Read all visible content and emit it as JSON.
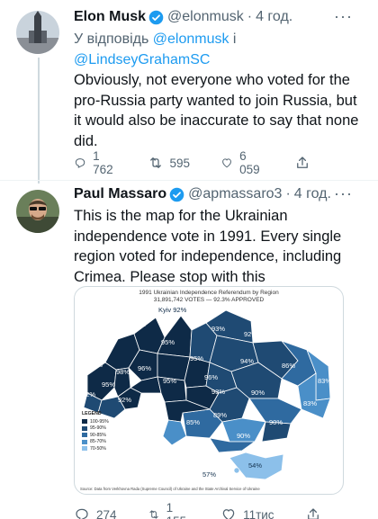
{
  "tweets": [
    {
      "display_name": "Elon Musk",
      "handle": "@elonmusk",
      "separator": "·",
      "time": "4 год.",
      "reply_prefix": "У відповідь",
      "reply_users": [
        "@elonmusk",
        "і",
        "@LindseyGrahamSC"
      ],
      "text": "Obviously, not everyone who voted for the pro-Russia party wanted to join Russia, but it would also be inaccurate to say that none did.",
      "reply_count": "",
      "retweet_count": "1 762",
      "retweet_count_b": "595",
      "like_count": "6 059"
    },
    {
      "display_name": "Paul Massaro",
      "handle": "@apmassaro3",
      "separator": "·",
      "time": "4 год.",
      "text": "This is the map for the Ukrainian independence vote in 1991. Every single region voted for independence, including Crimea. Please stop with this",
      "reply_count": "274",
      "retweet_count": "1 155",
      "like_count": "11тис"
    }
  ],
  "map": {
    "title_line1": "1991 Ukrainian Independence Referendum by Region",
    "title_line2": "31,891,742 VOTES — 92.3% APPROVED",
    "capital_label": "Kyiv 92%",
    "legend_title": "LEGEND",
    "legend": [
      {
        "label": "100-95%",
        "color": "#0e2a47"
      },
      {
        "label": "95-90%",
        "color": "#1f4a73"
      },
      {
        "label": "90-85%",
        "color": "#2f6aa0"
      },
      {
        "label": "85-70%",
        "color": "#4a8fc8"
      },
      {
        "label": "70-50%",
        "color": "#8cc0ea"
      }
    ],
    "region_labels": [
      "95%",
      "96%",
      "93%",
      "92%",
      "95%",
      "97%",
      "95%",
      "94%",
      "98%",
      "96%",
      "95%",
      "96%",
      "86%",
      "92%",
      "92%",
      "95%",
      "93%",
      "90%",
      "83%",
      "85%",
      "89%",
      "83%",
      "90%",
      "90%",
      "54%",
      "57%"
    ],
    "source": "Source: Data from Verkhovna Rada (Supreme Council) of Ukraine and the State Archival Service of Ukraine"
  },
  "icons": {
    "more": "more-icon",
    "verified": "verified-badge-icon",
    "reply": "reply-icon",
    "retweet": "retweet-icon",
    "like": "heart-icon",
    "share": "share-icon"
  },
  "colors": {
    "accent": "#1d9bf0",
    "secondary_text": "#536471"
  }
}
